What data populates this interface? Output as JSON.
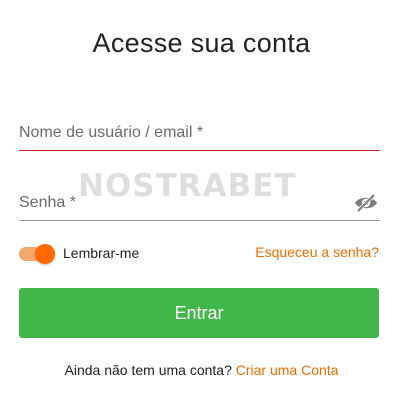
{
  "header": {
    "title": "Acesse sua conta"
  },
  "form": {
    "username": {
      "placeholder": "Nome de usuário / email *",
      "value": ""
    },
    "password": {
      "placeholder": "Senha *",
      "value": ""
    },
    "remember": {
      "label": "Lembrar-me",
      "checked": true
    },
    "forgot_link": "Esqueceu a senha?",
    "submit_label": "Entrar"
  },
  "footer": {
    "prompt": "Ainda não tem uma conta?",
    "signup_link": "Criar uma Conta"
  },
  "watermark": {
    "text": "NOSTRABET"
  },
  "colors": {
    "accent_orange": "#ef6c00",
    "toggle_knob": "#ff6a00",
    "toggle_track": "#f7a66c",
    "button_green": "#41b649",
    "error_underline": "#c62828"
  },
  "icons": {
    "password_visibility": "eye-slash-icon"
  }
}
